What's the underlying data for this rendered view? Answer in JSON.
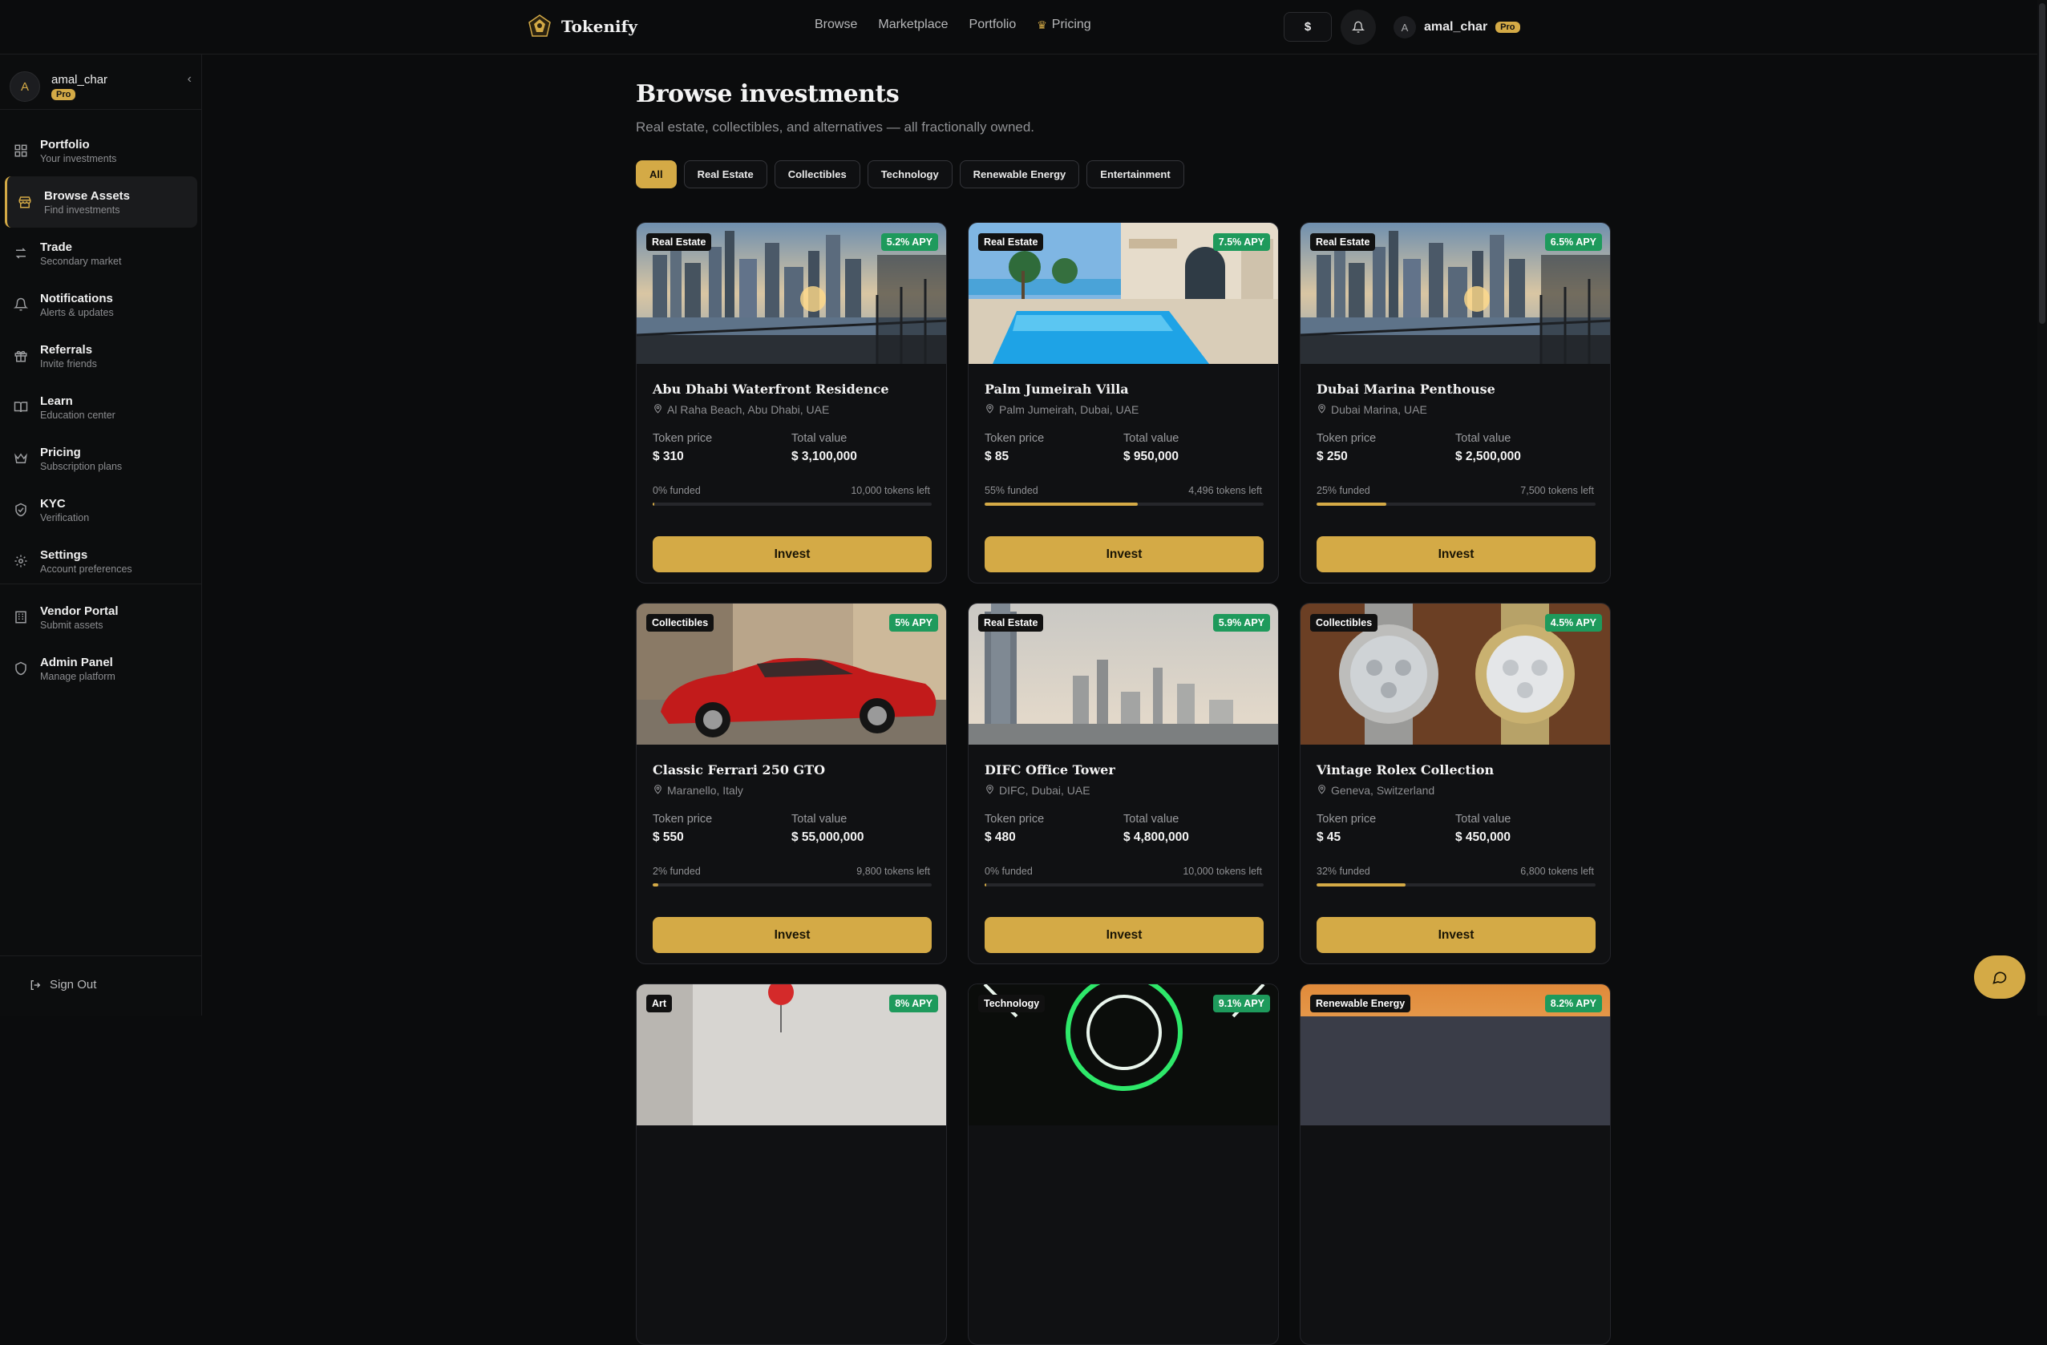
{
  "brand": {
    "name": "Tokenify",
    "accent": "#d4aa46",
    "apy_color": "#1e9a5c"
  },
  "topnav": {
    "items": [
      {
        "label": "Browse"
      },
      {
        "label": "Marketplace"
      },
      {
        "label": "Portfolio"
      },
      {
        "label": "Pricing",
        "icon": "crown-icon"
      }
    ]
  },
  "topbar": {
    "currency": "$",
    "user_initial": "A",
    "user_name": "amal_char",
    "plan": "Pro"
  },
  "sidebar": {
    "user": {
      "initial": "A",
      "name": "amal_char",
      "plan": "Pro"
    },
    "items": [
      {
        "label": "Portfolio",
        "sub": "Your investments",
        "icon": "grid-icon"
      },
      {
        "label": "Browse Assets",
        "sub": "Find investments",
        "icon": "store-icon",
        "active": true
      },
      {
        "label": "Trade",
        "sub": "Secondary market",
        "icon": "swap-icon"
      },
      {
        "label": "Notifications",
        "sub": "Alerts & updates",
        "icon": "bell-icon"
      },
      {
        "label": "Referrals",
        "sub": "Invite friends",
        "icon": "gift-icon"
      },
      {
        "label": "Learn",
        "sub": "Education center",
        "icon": "book-icon"
      },
      {
        "label": "Pricing",
        "sub": "Subscription plans",
        "icon": "crown-icon"
      },
      {
        "label": "KYC",
        "sub": "Verification",
        "icon": "shield-check-icon"
      },
      {
        "label": "Settings",
        "sub": "Account preferences",
        "icon": "gear-icon"
      }
    ],
    "items2": [
      {
        "label": "Vendor Portal",
        "sub": "Submit assets",
        "icon": "building-icon"
      },
      {
        "label": "Admin Panel",
        "sub": "Manage platform",
        "icon": "shield-icon"
      }
    ],
    "signout": "Sign Out"
  },
  "main": {
    "title": "Browse investments",
    "subtitle": "Real estate, collectibles, and alternatives — all fractionally owned.",
    "filters": [
      "All",
      "Real Estate",
      "Collectibles",
      "Technology",
      "Renewable Energy",
      "Entertainment"
    ],
    "active_filter": "All",
    "labels": {
      "token_price": "Token price",
      "total_value": "Total value",
      "invest": "Invest"
    },
    "cards": [
      {
        "category": "Real Estate",
        "apy": "5.2% APY",
        "title": "Abu Dhabi Waterfront Residence",
        "location": "Al Raha Beach, Abu Dhabi, UAE",
        "token_price": "$ 310",
        "total_value": "$ 3,100,000",
        "funded": "0% funded",
        "tokens_left": "10,000 tokens left",
        "funded_pct": 0,
        "image": "marina-skyline"
      },
      {
        "category": "Real Estate",
        "apy": "7.5% APY",
        "title": "Palm Jumeirah Villa",
        "location": "Palm Jumeirah, Dubai, UAE",
        "token_price": "$ 85",
        "total_value": "$ 950,000",
        "funded": "55% funded",
        "tokens_left": "4,496 tokens left",
        "funded_pct": 55,
        "image": "villa-pool"
      },
      {
        "category": "Real Estate",
        "apy": "6.5% APY",
        "title": "Dubai Marina Penthouse",
        "location": "Dubai Marina, UAE",
        "token_price": "$ 250",
        "total_value": "$ 2,500,000",
        "funded": "25% funded",
        "tokens_left": "7,500 tokens left",
        "funded_pct": 25,
        "image": "marina-skyline"
      },
      {
        "category": "Collectibles",
        "apy": "5% APY",
        "title": "Classic Ferrari 250 GTO",
        "location": "Maranello, Italy",
        "token_price": "$ 550",
        "total_value": "$ 55,000,000",
        "funded": "2% funded",
        "tokens_left": "9,800 tokens left",
        "funded_pct": 2,
        "image": "red-car"
      },
      {
        "category": "Real Estate",
        "apy": "5.9% APY",
        "title": "DIFC Office Tower",
        "location": "DIFC, Dubai, UAE",
        "token_price": "$ 480",
        "total_value": "$ 4,800,000",
        "funded": "0% funded",
        "tokens_left": "10,000 tokens left",
        "funded_pct": 0,
        "image": "tower-skyline"
      },
      {
        "category": "Collectibles",
        "apy": "4.5% APY",
        "title": "Vintage Rolex Collection",
        "location": "Geneva, Switzerland",
        "token_price": "$ 45",
        "total_value": "$ 450,000",
        "funded": "32% funded",
        "tokens_left": "6,800 tokens left",
        "funded_pct": 32,
        "image": "watches"
      },
      {
        "category": "Art",
        "apy": "8% APY",
        "image": "art"
      },
      {
        "category": "Technology",
        "apy": "9.1% APY",
        "image": "tech"
      },
      {
        "category": "Renewable Energy",
        "apy": "8.2% APY",
        "image": "solar"
      }
    ]
  },
  "chat": {
    "icon": "chat-icon"
  }
}
